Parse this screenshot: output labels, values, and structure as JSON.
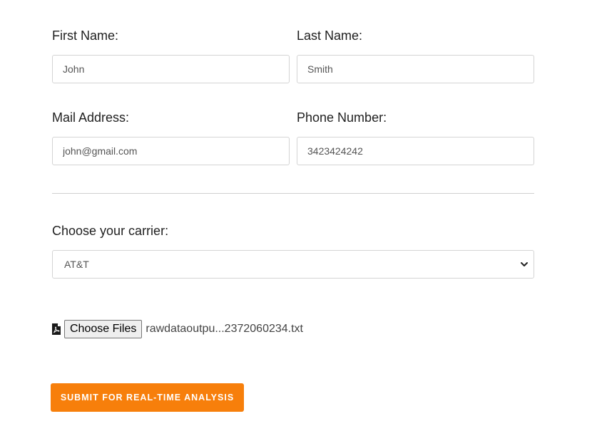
{
  "form": {
    "first_name": {
      "label": "First Name:",
      "value": "John"
    },
    "last_name": {
      "label": "Last Name:",
      "value": "Smith"
    },
    "email": {
      "label": "Mail Address:",
      "value": "john@gmail.com"
    },
    "phone": {
      "label": "Phone Number:",
      "value": "3423424242"
    },
    "carrier": {
      "label": "Choose your carrier:",
      "selected": "AT&T"
    },
    "file_upload": {
      "icon": "file-pdf-icon",
      "button_label": "Choose Files",
      "file_name": "rawdataoutpu...2372060234.txt"
    },
    "submit": {
      "label": "SUBMIT FOR REAL-TIME ANALYSIS",
      "color": "#f77f0b"
    }
  }
}
